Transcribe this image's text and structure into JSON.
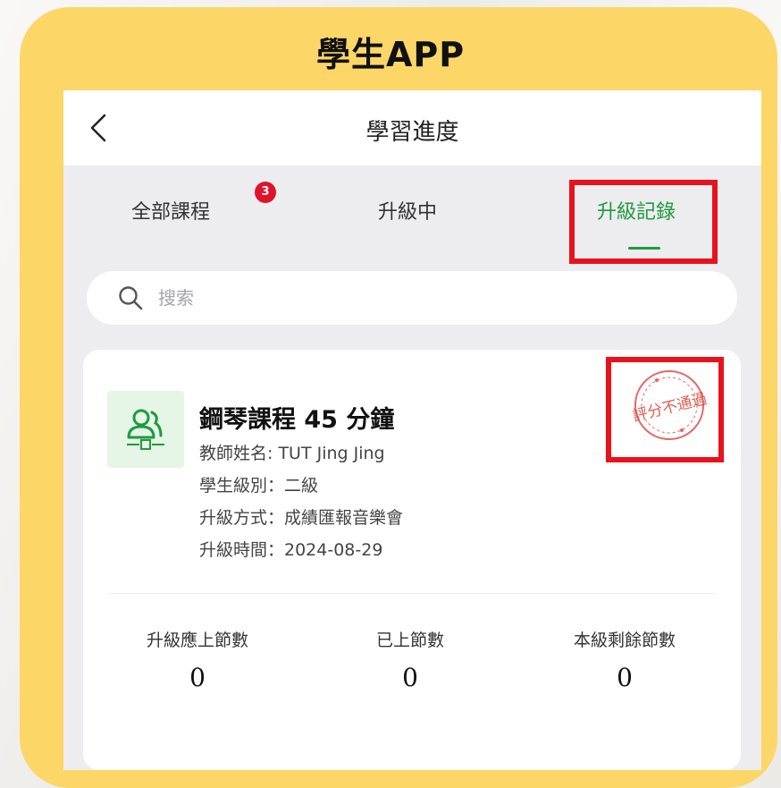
{
  "header": {
    "app_title": "學生APP"
  },
  "nav": {
    "title": "學習進度"
  },
  "tabs": [
    {
      "label": "全部課程",
      "badge": "3"
    },
    {
      "label": "升級中"
    },
    {
      "label": "升級記錄",
      "active": true
    }
  ],
  "search": {
    "placeholder": "搜索"
  },
  "course": {
    "title": "鋼琴課程 45 分鐘",
    "teacher": "教師姓名: TUT Jing Jing",
    "level": "學生級別：二級",
    "method": "升級方式：成績匯報音樂會",
    "time": "升級時間：2024-08-29",
    "stamp_text": "評分不通過",
    "stats": [
      {
        "label": "升級應上節數",
        "value": "0"
      },
      {
        "label": "已上節數",
        "value": "0"
      },
      {
        "label": "本級剩餘節數",
        "value": "0"
      }
    ]
  },
  "colors": {
    "accent": "#1f9a3f",
    "highlight_box": "#e8121c",
    "badge": "#e0132d",
    "background_card": "#fcd667"
  }
}
